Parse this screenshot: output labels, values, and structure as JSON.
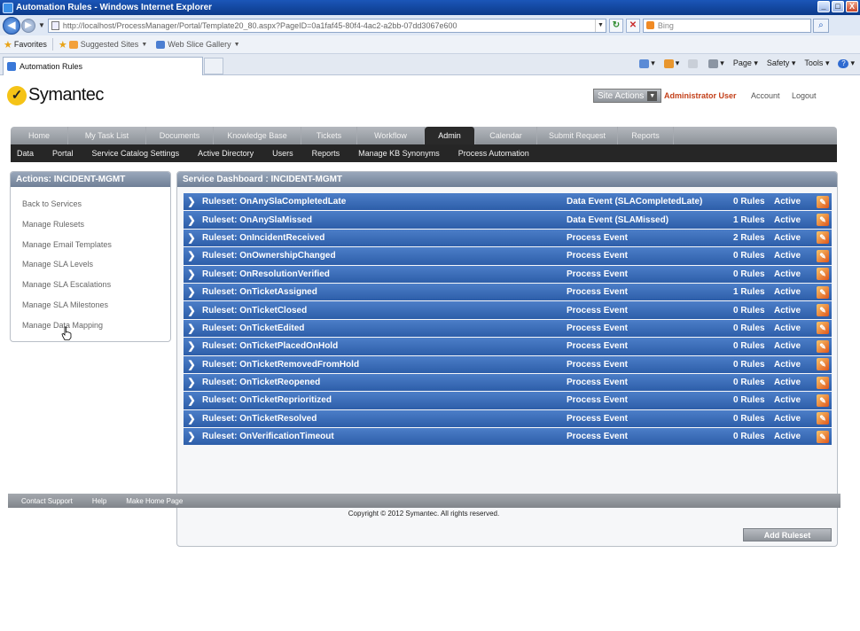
{
  "window": {
    "title": "Automation Rules - Windows Internet Explorer",
    "controls": [
      "_",
      "□",
      "X"
    ]
  },
  "browser": {
    "url": "http://localhost/ProcessManager/Portal/Template20_80.aspx?PageID=0a1faf45-80f4-4ac2-a2bb-07dd3067e600",
    "search_placeholder": "Bing",
    "favorites_label": "Favorites",
    "suggested_sites": "Suggested Sites",
    "web_slice_gallery": "Web Slice Gallery",
    "tab_title": "Automation Rules",
    "commands": {
      "page": "Page",
      "safety": "Safety",
      "tools": "Tools",
      "help": "?"
    }
  },
  "header": {
    "logo_text": "Symantec",
    "logo_mark": "✓",
    "site_actions": "Site Actions",
    "user": "Administrator User",
    "account": "Account",
    "logout": "Logout"
  },
  "nav": {
    "tabs": [
      {
        "label": "Home"
      },
      {
        "label": "My Task List"
      },
      {
        "label": "Documents"
      },
      {
        "label": "Knowledge Base"
      },
      {
        "label": "Tickets"
      },
      {
        "label": "Workflow"
      },
      {
        "label": "Admin"
      },
      {
        "label": "Calendar"
      },
      {
        "label": "Submit Request"
      },
      {
        "label": "Reports"
      }
    ],
    "active_tab": "Admin",
    "subnav": [
      {
        "label": "Data"
      },
      {
        "label": "Portal"
      },
      {
        "label": "Service Catalog Settings"
      },
      {
        "label": "Active Directory"
      },
      {
        "label": "Users"
      },
      {
        "label": "Reports"
      },
      {
        "label": "Manage KB Synonyms"
      },
      {
        "label": "Process Automation"
      }
    ]
  },
  "actions_panel": {
    "title": "Actions: INCIDENT-MGMT",
    "links": [
      {
        "label": "Back to Services"
      },
      {
        "label": "Manage Rulesets"
      },
      {
        "label": "Manage Email Templates"
      },
      {
        "label": "Manage SLA Levels"
      },
      {
        "label": "Manage SLA Escalations"
      },
      {
        "label": "Manage SLA Milestones"
      },
      {
        "label": "Manage Data Mapping"
      }
    ]
  },
  "dashboard": {
    "title": "Service Dashboard : INCIDENT-MGMT",
    "rows": [
      {
        "name": "Ruleset: OnAnySlaCompletedLate",
        "event": "Data Event (SLACompletedLate)",
        "rules": "0 Rules",
        "status": "Active"
      },
      {
        "name": "Ruleset: OnAnySlaMissed",
        "event": "Data Event (SLAMissed)",
        "rules": "1 Rules",
        "status": "Active"
      },
      {
        "name": "Ruleset: OnIncidentReceived",
        "event": "Process Event",
        "rules": "2 Rules",
        "status": "Active"
      },
      {
        "name": "Ruleset: OnOwnershipChanged",
        "event": "Process Event",
        "rules": "0 Rules",
        "status": "Active"
      },
      {
        "name": "Ruleset: OnResolutionVerified",
        "event": "Process Event",
        "rules": "0 Rules",
        "status": "Active"
      },
      {
        "name": "Ruleset: OnTicketAssigned",
        "event": "Process Event",
        "rules": "1 Rules",
        "status": "Active"
      },
      {
        "name": "Ruleset: OnTicketClosed",
        "event": "Process Event",
        "rules": "0 Rules",
        "status": "Active"
      },
      {
        "name": "Ruleset: OnTicketEdited",
        "event": "Process Event",
        "rules": "0 Rules",
        "status": "Active"
      },
      {
        "name": "Ruleset: OnTicketPlacedOnHold",
        "event": "Process Event",
        "rules": "0 Rules",
        "status": "Active"
      },
      {
        "name": "Ruleset: OnTicketRemovedFromHold",
        "event": "Process Event",
        "rules": "0 Rules",
        "status": "Active"
      },
      {
        "name": "Ruleset: OnTicketReopened",
        "event": "Process Event",
        "rules": "0 Rules",
        "status": "Active"
      },
      {
        "name": "Ruleset: OnTicketReprioritized",
        "event": "Process Event",
        "rules": "0 Rules",
        "status": "Active"
      },
      {
        "name": "Ruleset: OnTicketResolved",
        "event": "Process Event",
        "rules": "0 Rules",
        "status": "Active"
      },
      {
        "name": "Ruleset: OnVerificationTimeout",
        "event": "Process Event",
        "rules": "0 Rules",
        "status": "Active"
      }
    ],
    "add_button": "Add Ruleset"
  },
  "footer": {
    "links": [
      {
        "label": "Contact Support"
      },
      {
        "label": "Help"
      },
      {
        "label": "Make Home Page"
      }
    ],
    "copyright": "Copyright © 2012 Symantec. All rights reserved."
  },
  "colors": {
    "row_blue": "#3565b1",
    "admin_user_red": "#c3401a",
    "nav_gray": "#9a9ea4",
    "subnav_dark": "#262626"
  }
}
